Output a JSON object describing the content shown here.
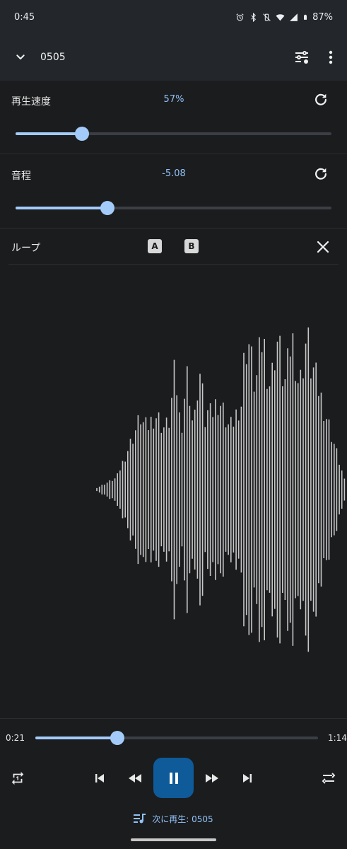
{
  "status_bar": {
    "time": "0:45",
    "battery": "87%",
    "icons": [
      "alarm-icon",
      "bluetooth-icon",
      "vibrate-off-icon",
      "wifi-icon",
      "signal-icon",
      "battery-icon"
    ]
  },
  "app_bar": {
    "title": "0505",
    "icons": [
      "chevron-down-icon",
      "equalizer-settings-icon",
      "more-vert-icon"
    ]
  },
  "speed": {
    "label": "再生速度",
    "value": "57%",
    "slider_fraction": 0.21
  },
  "pitch": {
    "label": "音程",
    "value": "-5.08",
    "slider_fraction": 0.29
  },
  "loop": {
    "label": "ループ",
    "a_label": "A",
    "b_label": "B"
  },
  "player": {
    "elapsed": "0:21",
    "duration": "1:14",
    "progress_fraction": 0.29,
    "next_label": "次に再生: 0505"
  },
  "colors": {
    "accent": "#a3cbf9",
    "accent_text": "#90c2f7",
    "play_button": "#0f5a99",
    "background": "#1b1c1e",
    "bar_background": "#23272c",
    "waveform": "#c8c8c8"
  }
}
